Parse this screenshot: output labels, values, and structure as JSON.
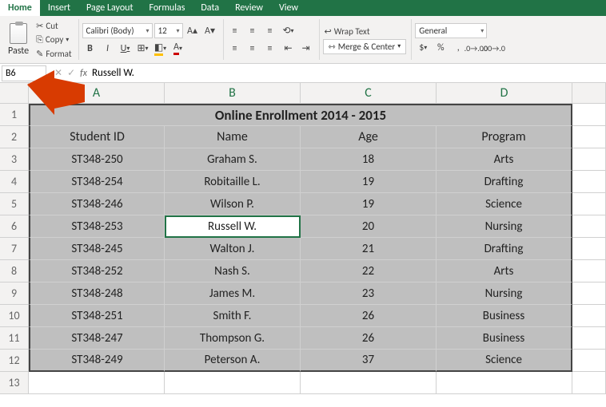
{
  "tabs": {
    "home": "Home",
    "insert": "Insert",
    "page_layout": "Page Layout",
    "formulas": "Formulas",
    "data": "Data",
    "review": "Review",
    "view": "View"
  },
  "ribbon": {
    "paste": "Paste",
    "cut": "Cut",
    "copy": "Copy",
    "format": "Format",
    "font_name": "Calibri (Body)",
    "font_size": "12",
    "wrap_text": "Wrap Text",
    "merge_center": "Merge & Center",
    "number_format": "General",
    "currency": "$",
    "percent": "%",
    "comma": ","
  },
  "formula_bar": {
    "cell_ref": "B6",
    "fx": "fx",
    "value": "Russell W."
  },
  "columns": [
    "A",
    "B",
    "C",
    "D"
  ],
  "sheet": {
    "title": "Online Enrollment 2014 - 2015",
    "headers": {
      "a": "Student ID",
      "b": "Name",
      "c": "Age",
      "d": "Program"
    },
    "rows": [
      {
        "id": "ST348-250",
        "name": "Graham S.",
        "age": "18",
        "program": "Arts"
      },
      {
        "id": "ST348-254",
        "name": "Robitaille L.",
        "age": "19",
        "program": "Drafting"
      },
      {
        "id": "ST348-246",
        "name": "Wilson P.",
        "age": "19",
        "program": "Science"
      },
      {
        "id": "ST348-253",
        "name": "Russell W.",
        "age": "20",
        "program": "Nursing"
      },
      {
        "id": "ST348-245",
        "name": "Walton J.",
        "age": "21",
        "program": "Drafting"
      },
      {
        "id": "ST348-252",
        "name": "Nash S.",
        "age": "22",
        "program": "Arts"
      },
      {
        "id": "ST348-248",
        "name": "James M.",
        "age": "23",
        "program": "Nursing"
      },
      {
        "id": "ST348-251",
        "name": "Smith F.",
        "age": "26",
        "program": "Business"
      },
      {
        "id": "ST348-247",
        "name": "Thompson G.",
        "age": "26",
        "program": "Business"
      },
      {
        "id": "ST348-249",
        "name": "Peterson A.",
        "age": "37",
        "program": "Science"
      }
    ]
  }
}
